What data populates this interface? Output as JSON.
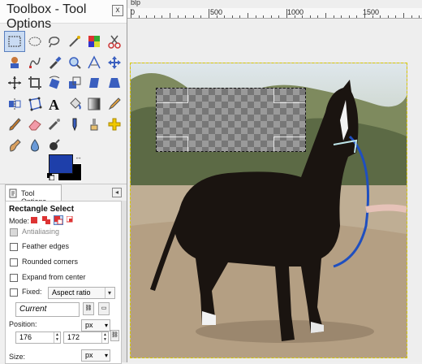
{
  "window": {
    "title": "Toolbox - Tool Options",
    "close_label": "x"
  },
  "colors": {
    "foreground": "#1e3faa",
    "background": "#000000",
    "accent": "#5a7fbe"
  },
  "tools": [
    "rect-select-icon",
    "ellipse-select-icon",
    "lasso-icon",
    "fuzzy-select-icon",
    "color-select-icon",
    "scissors-icon",
    "foreground-select-icon",
    "paths-icon",
    "color-picker-icon",
    "zoom-icon",
    "measure-icon",
    "move-icon",
    "align-icon",
    "crop-icon",
    "rotate-icon",
    "scale-icon",
    "shear-icon",
    "perspective-icon",
    "flip-icon",
    "cage-icon",
    "text-icon",
    "bucket-fill-icon",
    "blend-icon",
    "pencil-icon",
    "paintbrush-icon",
    "eraser-icon",
    "airbrush-icon",
    "ink-icon",
    "clone-icon",
    "heal-icon",
    "smudge-icon",
    "blur-icon",
    "dodge-burn-icon"
  ],
  "tab": {
    "label": "Tool Options",
    "menu": "◂"
  },
  "tool_options": {
    "title": "Rectangle Select",
    "mode_label": "Mode:",
    "antialiasing": "Antialiasing",
    "feather": "Feather edges",
    "rounded": "Rounded corners",
    "expand": "Expand from center",
    "fixed_label": "Fixed:",
    "fixed_value": "Aspect ratio",
    "current": "Current",
    "position_label": "Position:",
    "position_unit": "px",
    "position_x": "176",
    "position_y": "172",
    "size_label": "Size:",
    "size_unit": "px"
  },
  "ruler": {
    "corner": "blp",
    "labels": [
      "0",
      "500",
      "1000",
      "1500"
    ]
  }
}
